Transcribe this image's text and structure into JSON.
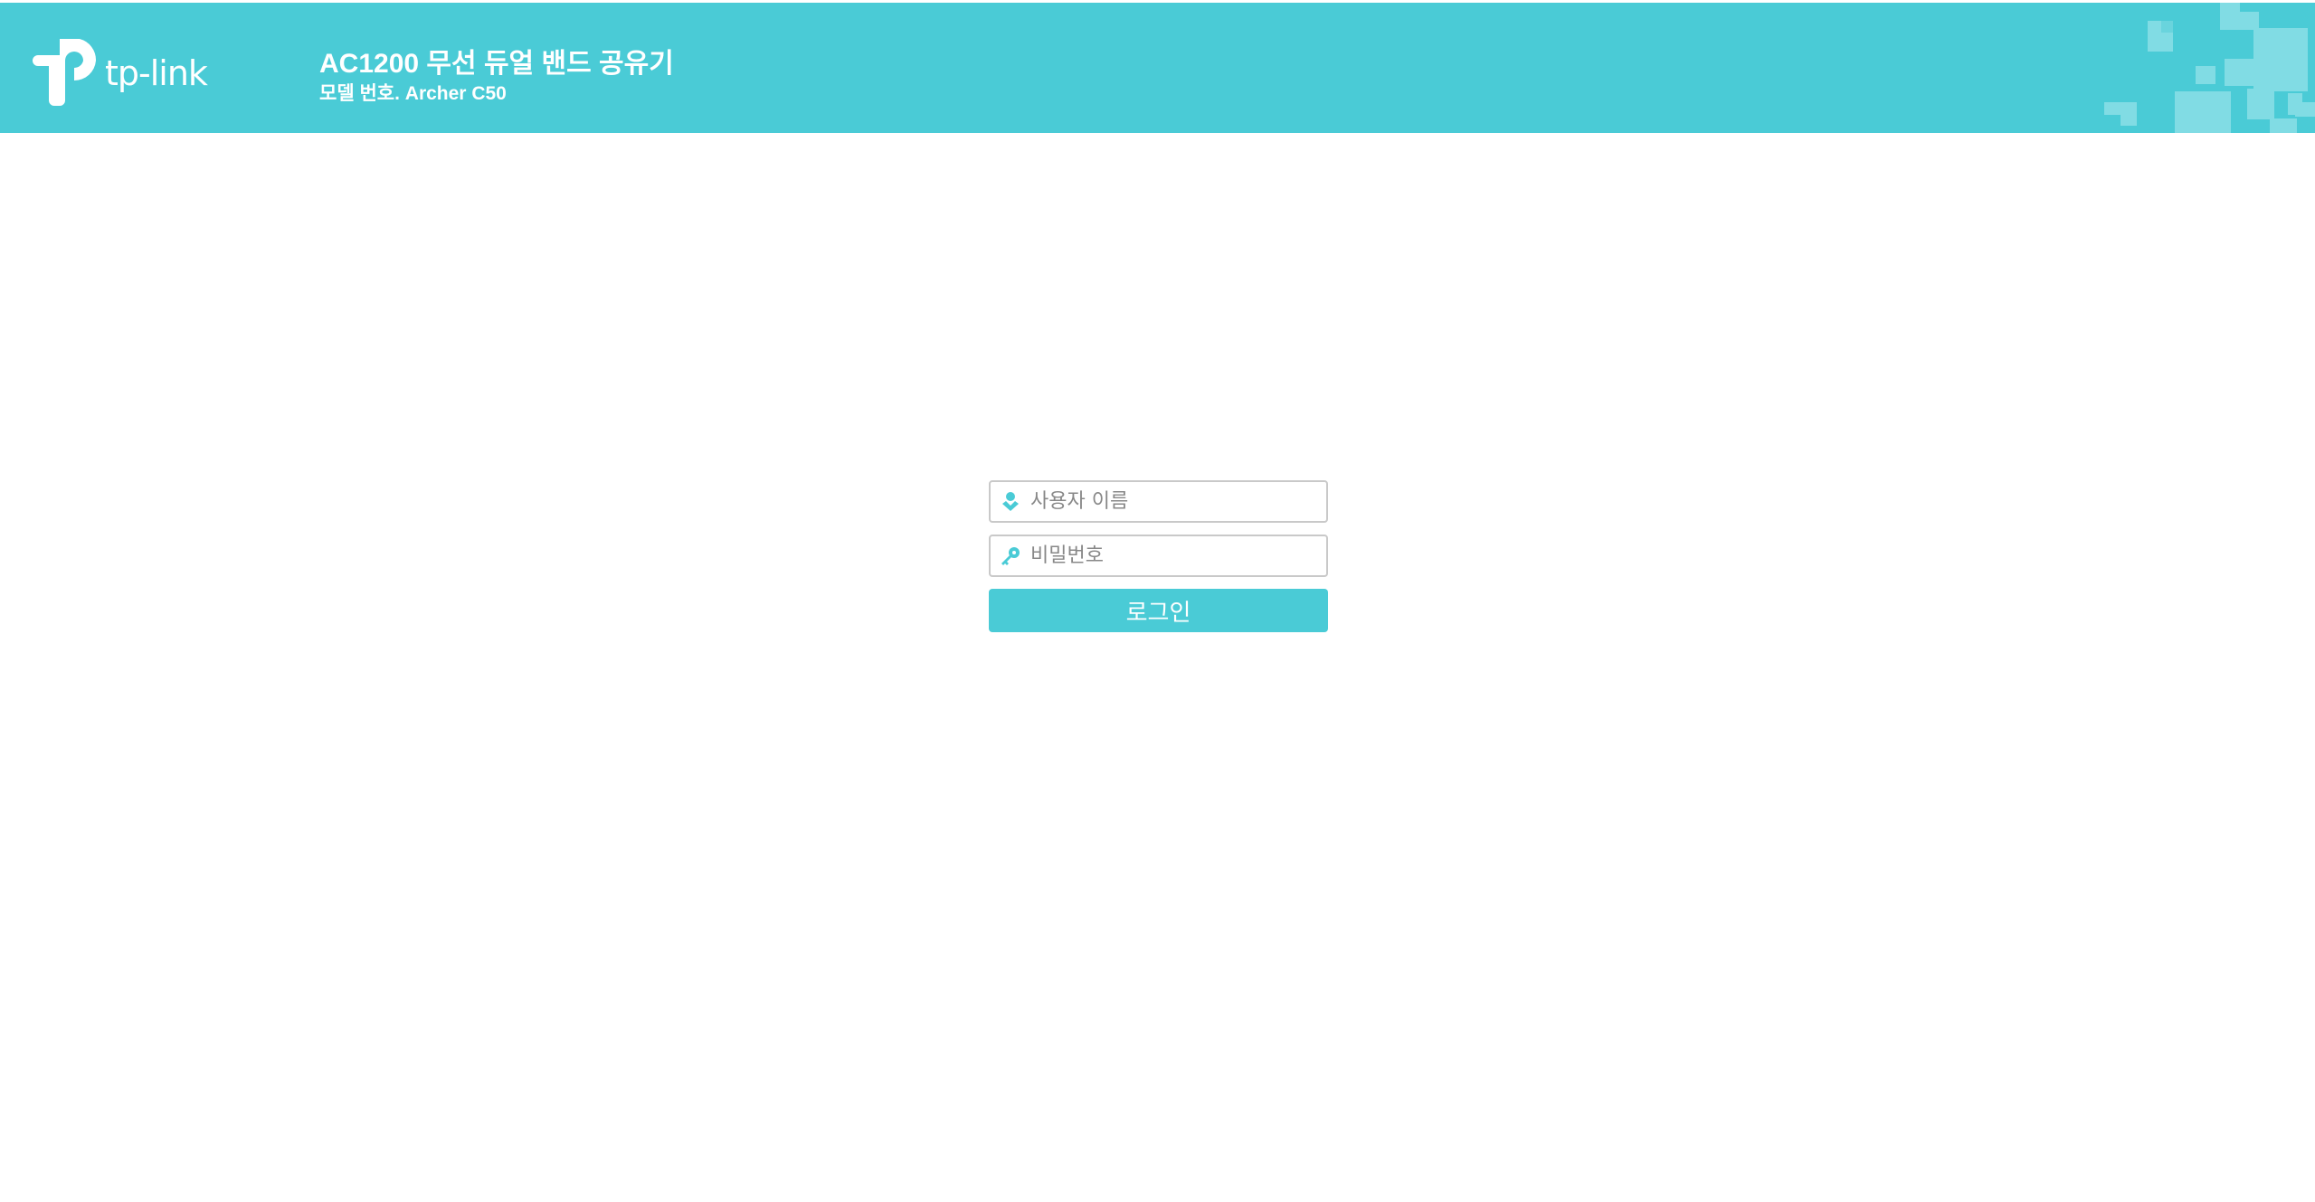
{
  "header": {
    "brand_text": "tp-link",
    "product_title": "AC1200 무선 듀얼 밴드 공유기",
    "model_line": "모델 번호. Archer C50"
  },
  "login": {
    "username_placeholder": "사용자 이름",
    "password_placeholder": "비밀번호",
    "login_label": "로그인"
  },
  "icons": {
    "brand_logo": "tp-link-logo-icon",
    "username": "user-icon",
    "password": "key-icon"
  },
  "colors": {
    "accent": "#4acbd6",
    "deco": "#8be0e7",
    "border": "#c9c9c9",
    "placeholder": "#888888"
  }
}
